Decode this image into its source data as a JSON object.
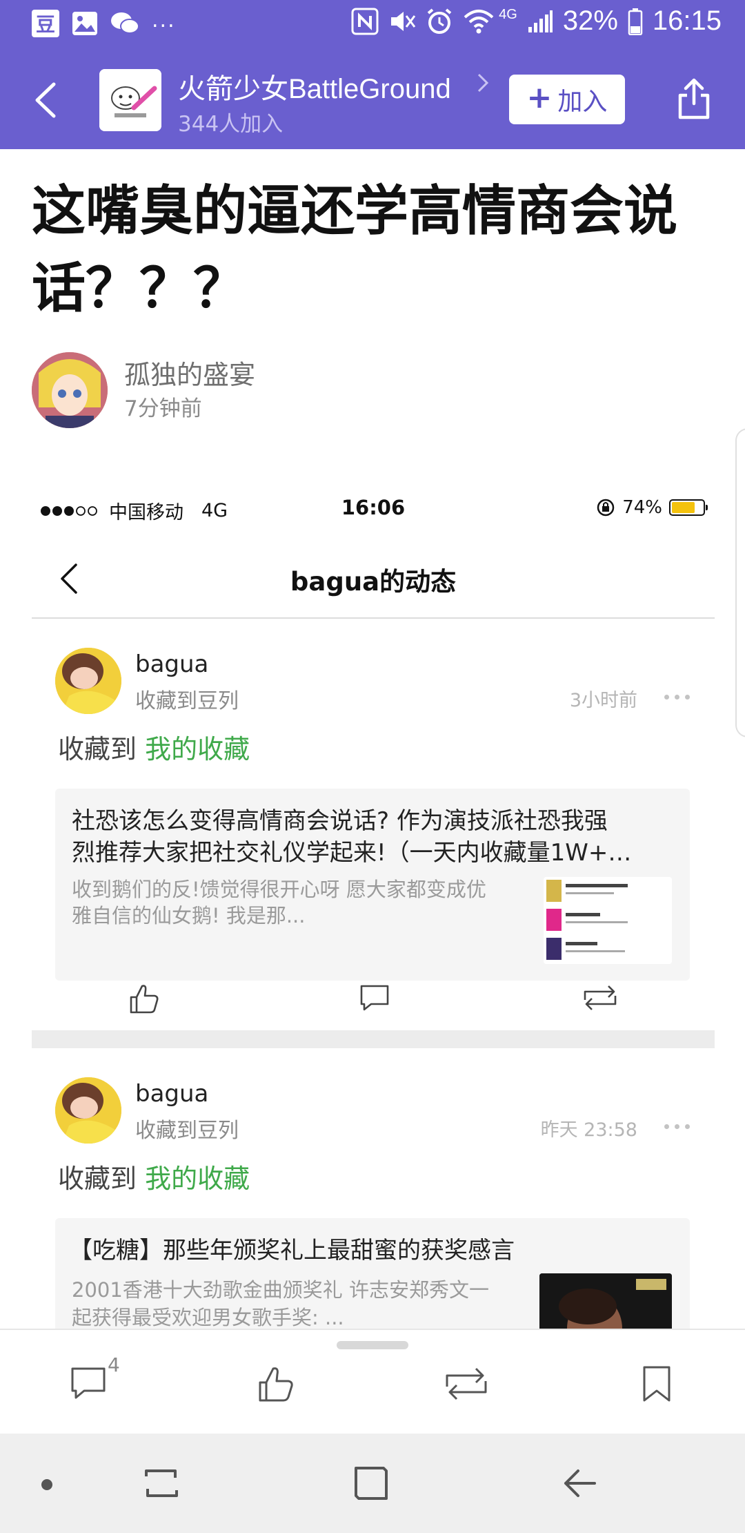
{
  "status_bar": {
    "app_icon_label": "豆",
    "overflow": "...",
    "network": "4G",
    "battery": "32%",
    "time": "16:15"
  },
  "group": {
    "name": "火箭少女BattleGround",
    "member_count": "344人加入",
    "join_label": "加入"
  },
  "post": {
    "title": "这嘴臭的逼还学高情商会说话？？？",
    "author": "孤独的盛宴",
    "time": "7分钟前"
  },
  "embedded_screenshot": {
    "status": {
      "carrier": "中国移动",
      "network": "4G",
      "time": "16:06",
      "battery": "74%",
      "battery_level": 0.74
    },
    "nav_title": "bagua的动态",
    "items": [
      {
        "user": "bagua",
        "action": "收藏到豆列",
        "time": "3小时前",
        "collect_prefix": "收藏到",
        "collect_target": "我的收藏",
        "card_title_line1": "社恐该怎么变得高情商会说话? 作为演技派社恐我强",
        "card_title_line2": "烈推荐大家把社交礼仪学起来!（一天内收藏量1W+…",
        "card_desc_line1": "收到鹅们的反!馈觉得很开心呀 愿大家都变成优",
        "card_desc_line2": "雅自信的仙女鹅! 我是那..."
      },
      {
        "user": "bagua",
        "action": "收藏到豆列",
        "time": "昨天 23:58",
        "collect_prefix": "收藏到",
        "collect_target": "我的收藏",
        "card_title_line1": "【吃糖】那些年颁奖礼上最甜蜜的获奖感言",
        "card_desc_line1": "2001香港十大劲歌金曲颁奖礼 许志安郑秀文一",
        "card_desc_line2": "起获得最受欢迎男女歌手奖: ..."
      }
    ]
  },
  "toolbar": {
    "comment_count": "4"
  },
  "colors": {
    "header_purple": "#6a5fcf",
    "douban_green": "#3fa94a"
  }
}
